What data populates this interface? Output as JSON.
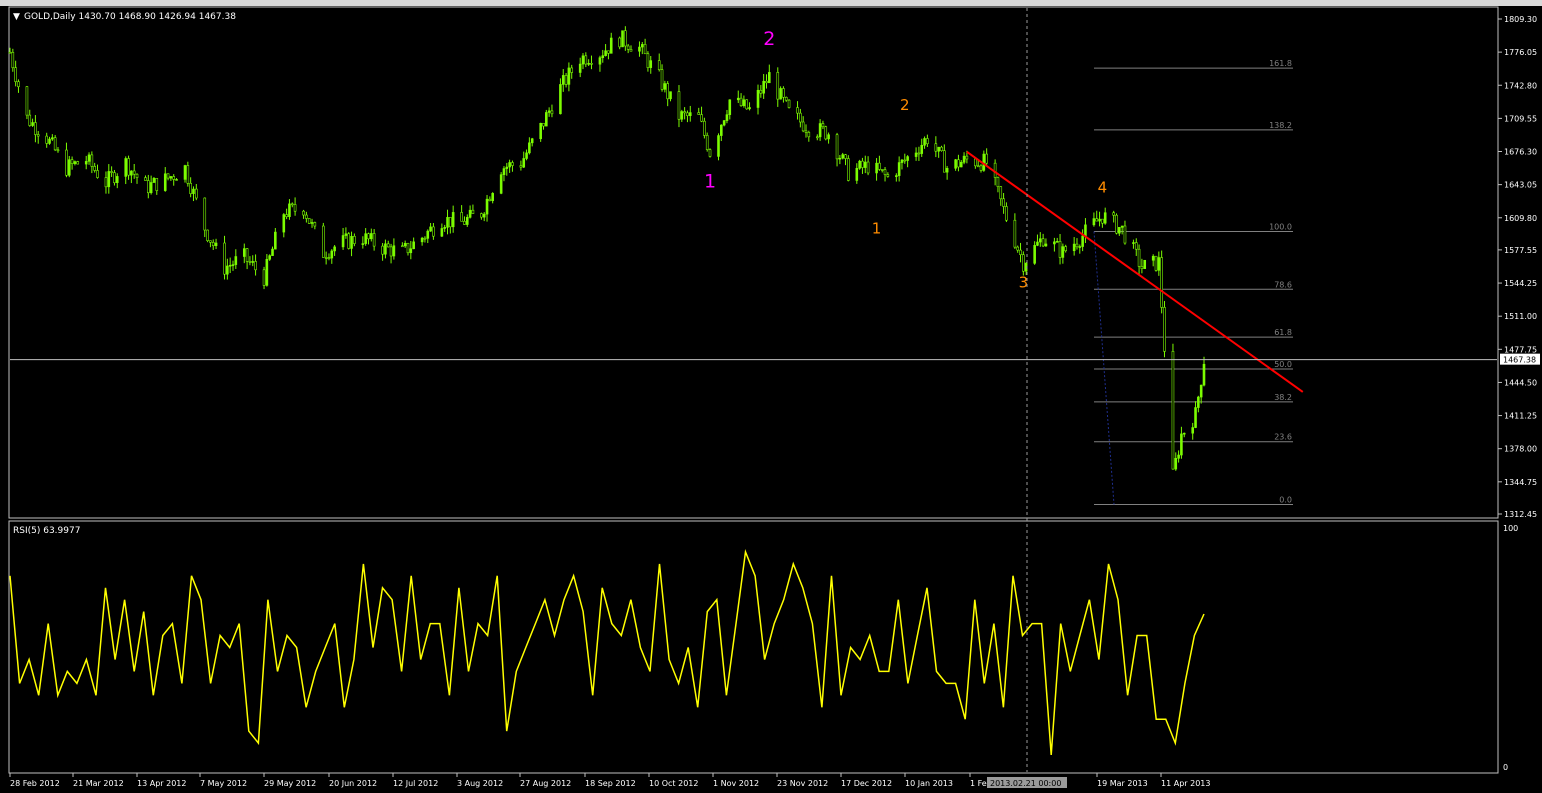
{
  "window": {
    "symbol_header": "GOLD,Daily  1430.70 1468.90 1426.94 1467.38",
    "current_price_tag": "1467.38",
    "crosshair_time_tag": "2013.02.21 00:00"
  },
  "colors": {
    "background": "#000000",
    "bull_candle": "#7CFC00",
    "bear_candle": "#ffffff",
    "trendline": "#ff0000",
    "rsi_line": "#ffff00",
    "fib_line": "#808080",
    "wave_major": "#ff00ff",
    "wave_minor": "#ff8c00",
    "axis_text": "#ffffff"
  },
  "chart_data": [
    {
      "type": "candlestick",
      "title": "GOLD,Daily",
      "last_values": {
        "open": 1430.7,
        "high": 1468.9,
        "low": 1426.94,
        "close": 1467.38
      },
      "x_tick_labels": [
        "28 Feb 2012",
        "21 Mar 2012",
        "13 Apr 2012",
        "7 May 2012",
        "29 May 2012",
        "20 Jun 2012",
        "12 Jul 2012",
        "3 Aug 2012",
        "27 Aug 2012",
        "18 Sep 2012",
        "10 Oct 2012",
        "1 Nov 2012",
        "23 Nov 2012",
        "17 Dec 2012",
        "10 Jan 2013",
        "1 Feb 2013",
        "19 Mar 2013",
        "11 Apr 2013"
      ],
      "y_tick_labels": [
        "1809.30",
        "1776.05",
        "1742.80",
        "1709.55",
        "1676.30",
        "1643.05",
        "1609.80",
        "1577.55",
        "1544.25",
        "1511.00",
        "1477.75",
        "1444.50",
        "1411.25",
        "1378.00",
        "1344.75",
        "1312.45"
      ],
      "ylim": [
        1312.45,
        1809.3
      ],
      "grid": false,
      "close_path": [
        {
          "date": "2012-02-28",
          "close": 1776
        },
        {
          "date": "2012-03-05",
          "close": 1710
        },
        {
          "date": "2012-03-12",
          "close": 1690
        },
        {
          "date": "2012-03-19",
          "close": 1660
        },
        {
          "date": "2012-03-26",
          "close": 1668
        },
        {
          "date": "2012-04-02",
          "close": 1645
        },
        {
          "date": "2012-04-09",
          "close": 1665
        },
        {
          "date": "2012-04-16",
          "close": 1640
        },
        {
          "date": "2012-04-23",
          "close": 1648
        },
        {
          "date": "2012-04-30",
          "close": 1660
        },
        {
          "date": "2012-05-07",
          "close": 1600
        },
        {
          "date": "2012-05-14",
          "close": 1560
        },
        {
          "date": "2012-05-21",
          "close": 1570
        },
        {
          "date": "2012-05-28",
          "close": 1550
        },
        {
          "date": "2012-06-04",
          "close": 1615
        },
        {
          "date": "2012-06-11",
          "close": 1620
        },
        {
          "date": "2012-06-18",
          "close": 1575
        },
        {
          "date": "2012-06-25",
          "close": 1585
        },
        {
          "date": "2012-07-02",
          "close": 1590
        },
        {
          "date": "2012-07-09",
          "close": 1580
        },
        {
          "date": "2012-07-16",
          "close": 1575
        },
        {
          "date": "2012-07-23",
          "close": 1590
        },
        {
          "date": "2012-07-30",
          "close": 1608
        },
        {
          "date": "2012-08-06",
          "close": 1605
        },
        {
          "date": "2012-08-13",
          "close": 1615
        },
        {
          "date": "2012-08-20",
          "close": 1660
        },
        {
          "date": "2012-08-27",
          "close": 1665
        },
        {
          "date": "2012-09-03",
          "close": 1700
        },
        {
          "date": "2012-09-10",
          "close": 1740
        },
        {
          "date": "2012-09-17",
          "close": 1770
        },
        {
          "date": "2012-09-24",
          "close": 1775
        },
        {
          "date": "2012-10-01",
          "close": 1790
        },
        {
          "date": "2012-10-08",
          "close": 1780
        },
        {
          "date": "2012-10-15",
          "close": 1750
        },
        {
          "date": "2012-10-22",
          "close": 1712
        },
        {
          "date": "2012-10-29",
          "close": 1710
        },
        {
          "date": "2012-11-02",
          "close": 1676
        },
        {
          "date": "2012-11-09",
          "close": 1728
        },
        {
          "date": "2012-11-16",
          "close": 1718
        },
        {
          "date": "2012-11-23",
          "close": 1752
        },
        {
          "date": "2012-11-30",
          "close": 1715
        },
        {
          "date": "2012-12-07",
          "close": 1700
        },
        {
          "date": "2012-12-14",
          "close": 1695
        },
        {
          "date": "2012-12-21",
          "close": 1655
        },
        {
          "date": "2012-12-28",
          "close": 1662
        },
        {
          "date": "2013-01-04",
          "close": 1650
        },
        {
          "date": "2013-01-11",
          "close": 1670
        },
        {
          "date": "2013-01-18",
          "close": 1690
        },
        {
          "date": "2013-01-25",
          "close": 1660
        },
        {
          "date": "2013-02-01",
          "close": 1668
        },
        {
          "date": "2013-02-08",
          "close": 1665
        },
        {
          "date": "2013-02-15",
          "close": 1610
        },
        {
          "date": "2013-02-21",
          "close": 1565
        },
        {
          "date": "2013-02-28",
          "close": 1590
        },
        {
          "date": "2013-03-07",
          "close": 1575
        },
        {
          "date": "2013-03-14",
          "close": 1592
        },
        {
          "date": "2013-03-21",
          "close": 1612
        },
        {
          "date": "2013-03-28",
          "close": 1598
        },
        {
          "date": "2013-04-04",
          "close": 1560
        },
        {
          "date": "2013-04-10",
          "close": 1565
        },
        {
          "date": "2013-04-12",
          "close": 1480
        },
        {
          "date": "2013-04-15",
          "close": 1350
        },
        {
          "date": "2013-04-18",
          "close": 1392
        },
        {
          "date": "2013-04-23",
          "close": 1412
        },
        {
          "date": "2013-04-26",
          "close": 1467.38
        }
      ],
      "fibonacci": [
        {
          "label": "161.8",
          "price": 1760
        },
        {
          "label": "138.2",
          "price": 1698
        },
        {
          "label": "100.0",
          "price": 1596
        },
        {
          "label": "78.6",
          "price": 1538
        },
        {
          "label": "61.8",
          "price": 1490
        },
        {
          "label": "50.0",
          "price": 1458
        },
        {
          "label": "38.2",
          "price": 1425
        },
        {
          "label": "23.6",
          "price": 1385
        },
        {
          "label": "0.0",
          "price": 1322
        }
      ],
      "trendline": {
        "from": {
          "date": "2013-02-01",
          "price": 1676
        },
        "to": {
          "date": "2013-05-31",
          "price": 1435
        }
      },
      "wave_labels": [
        {
          "text": "1",
          "kind": "major",
          "date": "2012-11-02",
          "price": 1640
        },
        {
          "text": "2",
          "kind": "major",
          "date": "2012-11-23",
          "price": 1783
        },
        {
          "text": "2",
          "kind": "minor",
          "date": "2013-01-10",
          "price": 1718
        },
        {
          "text": "1",
          "kind": "minor",
          "date": "2012-12-31",
          "price": 1594
        },
        {
          "text": "3",
          "kind": "minor",
          "date": "2013-02-21",
          "price": 1540
        },
        {
          "text": "4",
          "kind": "minor",
          "date": "2013-03-21",
          "price": 1635
        }
      ]
    },
    {
      "type": "line",
      "title": "RSI(5) 63.9977",
      "ylim": [
        0,
        100
      ],
      "y_tick_labels": [
        "100",
        "0"
      ],
      "series": [
        {
          "name": "RSI(5)",
          "values": [
            80,
            35,
            45,
            30,
            60,
            30,
            40,
            35,
            45,
            30,
            75,
            45,
            70,
            40,
            65,
            30,
            55,
            60,
            35,
            80,
            70,
            35,
            55,
            50,
            60,
            15,
            10,
            70,
            40,
            55,
            50,
            25,
            40,
            50,
            60,
            25,
            45,
            85,
            50,
            75,
            70,
            40,
            80,
            45,
            60,
            60,
            30,
            75,
            40,
            60,
            55,
            80,
            15,
            40,
            50,
            60,
            70,
            55,
            70,
            80,
            65,
            30,
            75,
            60,
            55,
            70,
            50,
            40,
            85,
            45,
            35,
            50,
            25,
            65,
            70,
            30,
            60,
            90,
            80,
            45,
            60,
            70,
            85,
            75,
            60,
            25,
            80,
            30,
            50,
            45,
            55,
            40,
            40,
            70,
            35,
            55,
            75,
            40,
            35,
            35,
            20,
            70,
            35,
            60,
            25,
            80,
            55,
            60,
            60,
            5,
            60,
            40,
            55,
            70,
            45,
            85,
            70,
            30,
            55,
            55,
            20,
            20,
            10,
            35,
            55,
            64
          ]
        }
      ]
    }
  ]
}
